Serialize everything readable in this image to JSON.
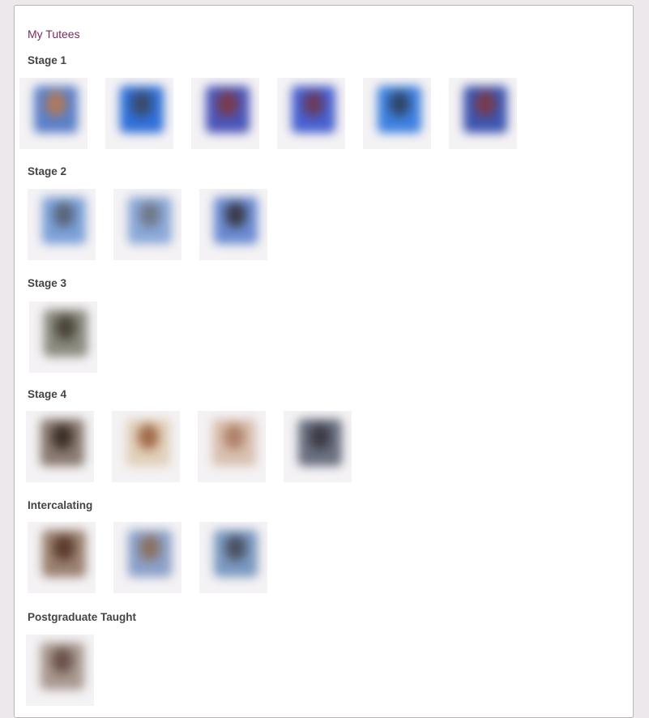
{
  "panel": {
    "title": "My Tutees"
  },
  "sections": [
    {
      "heading": "Stage 1",
      "photos": [
        {
          "icon": "tutee-photo-icon",
          "bg": "#5a7fc8",
          "face": "#b07a5a"
        },
        {
          "icon": "tutee-photo-icon",
          "bg": "#2f6fd8",
          "face": "#3a4a6a"
        },
        {
          "icon": "tutee-photo-icon",
          "bg": "#4a55b8",
          "face": "#7a3a4a"
        },
        {
          "icon": "tutee-photo-icon",
          "bg": "#4660d0",
          "face": "#6a3a5a"
        },
        {
          "icon": "tutee-photo-icon",
          "bg": "#3d80e0",
          "face": "#2f4568"
        },
        {
          "icon": "tutee-photo-icon",
          "bg": "#3d55b0",
          "face": "#7a3a4a"
        }
      ]
    },
    {
      "heading": "Stage 2",
      "photos": [
        {
          "icon": "tutee-photo-icon",
          "bg": "#7aa0d8",
          "face": "#5a6478"
        },
        {
          "icon": "tutee-photo-icon",
          "bg": "#8aa8d8",
          "face": "#707888"
        },
        {
          "icon": "tutee-photo-icon",
          "bg": "#6a8ad0",
          "face": "#3a3a48"
        }
      ]
    },
    {
      "heading": "Stage 3",
      "photos": [
        {
          "icon": "tutee-photo-icon",
          "bg": "#8a8a80",
          "face": "#4a4438"
        }
      ]
    },
    {
      "heading": "Stage 4",
      "photos": [
        {
          "icon": "tutee-photo-icon",
          "bg": "#8a7a70",
          "face": "#3a2e28"
        },
        {
          "icon": "tutee-photo-icon",
          "bg": "#e0cfb8",
          "face": "#a06a48"
        },
        {
          "icon": "tutee-photo-icon",
          "bg": "#d8c0b0",
          "face": "#b08068"
        },
        {
          "icon": "tutee-photo-icon",
          "bg": "#6a7080",
          "face": "#3a3a44"
        }
      ]
    },
    {
      "heading": "Intercalating",
      "photos": [
        {
          "icon": "tutee-photo-icon",
          "bg": "#9a8070",
          "face": "#5a3a2a"
        },
        {
          "icon": "tutee-photo-icon",
          "bg": "#8aa0c8",
          "face": "#8a7060"
        },
        {
          "icon": "tutee-photo-icon",
          "bg": "#7a98c0",
          "face": "#4a5060"
        }
      ]
    },
    {
      "heading": "Postgraduate Taught",
      "photos": [
        {
          "icon": "tutee-photo-icon",
          "bg": "#a89890",
          "face": "#6a5048"
        }
      ]
    }
  ]
}
